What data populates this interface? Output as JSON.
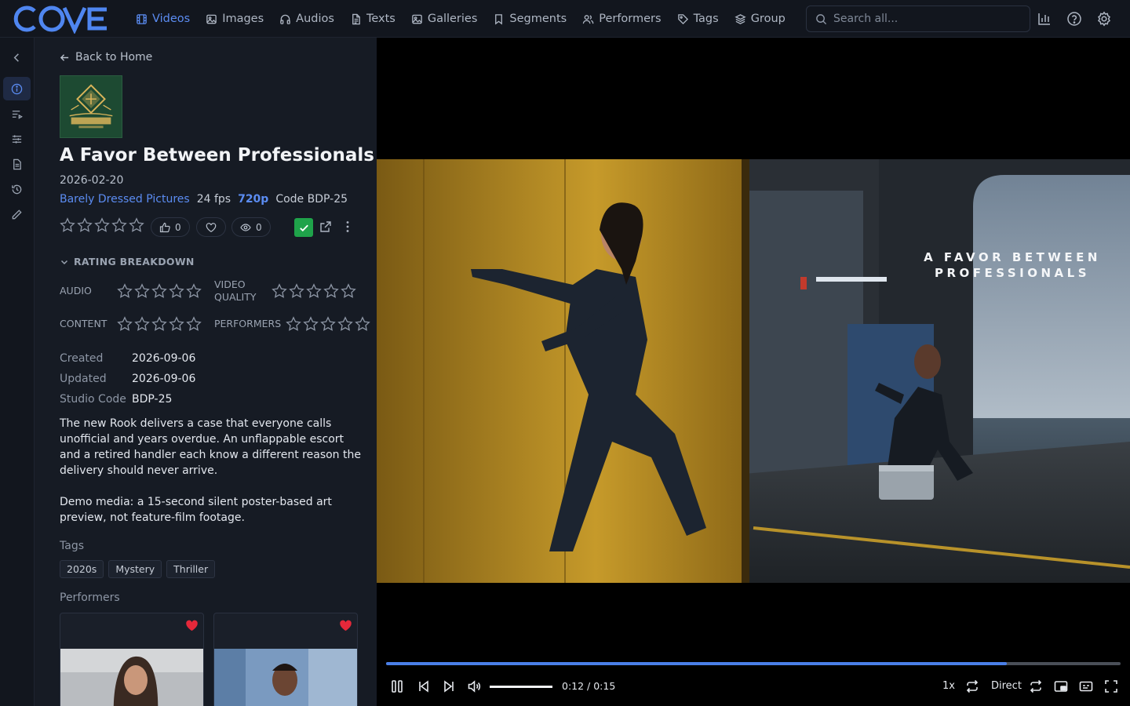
{
  "app": {
    "logo_text": "COVE"
  },
  "nav": {
    "items": [
      {
        "label": "Videos",
        "icon": "film-icon",
        "active": true
      },
      {
        "label": "Images",
        "icon": "image-icon"
      },
      {
        "label": "Audios",
        "icon": "headphones-icon"
      },
      {
        "label": "Texts",
        "icon": "document-icon"
      },
      {
        "label": "Galleries",
        "icon": "gallery-icon"
      },
      {
        "label": "Segments",
        "icon": "bookmark-icon"
      },
      {
        "label": "Performers",
        "icon": "users-icon"
      },
      {
        "label": "Tags",
        "icon": "tag-icon"
      },
      {
        "label": "Group",
        "icon": "layers-icon"
      }
    ]
  },
  "search": {
    "placeholder": "Search all..."
  },
  "panel": {
    "back_label": "Back to Home",
    "studio_logo_text": "BARELY DRESSED PICTURES",
    "title": "A Favor Between Professionals",
    "date": "2026-02-20",
    "studio": "Barely Dressed Pictures",
    "fps": "24 fps",
    "resolution": "720p",
    "code_label": "Code BDP-25",
    "rating_stars": 0,
    "likes": "0",
    "views": "0",
    "rating_breakdown": {
      "header": "RATING BREAKDOWN",
      "audio": "AUDIO",
      "video_quality_1": "VIDEO",
      "video_quality_2": "QUALITY",
      "content": "CONTENT",
      "performers": "PERFORMERS"
    },
    "details": [
      {
        "key": "Created",
        "value": "2026-09-06"
      },
      {
        "key": "Updated",
        "value": "2026-09-06"
      },
      {
        "key": "Studio Code",
        "value": "BDP-25"
      }
    ],
    "description": [
      "The new Rook delivers a case that everyone calls unofficial and years overdue. An unflappable escort and a retired handler each know a different reason the delivery should never arrive.",
      "Demo media: a 15-second silent poster-based art preview, not feature-film footage."
    ],
    "tags_label": "Tags",
    "tags": [
      "2020s",
      "Mystery",
      "Thriller"
    ],
    "performers_label": "Performers"
  },
  "player": {
    "frame_title_1": "A FAVOR BETWEEN",
    "frame_title_2": "PROFESSIONALS",
    "progress_fraction": 0.845,
    "volume_fraction": 1.0,
    "time": "0:12 / 0:15",
    "speed": "1x",
    "source": "Direct"
  },
  "colors": {
    "accent": "#5b8cf2",
    "progress": "#4a7fe8",
    "check": "#1fa34a",
    "heart": "#e5283a"
  }
}
